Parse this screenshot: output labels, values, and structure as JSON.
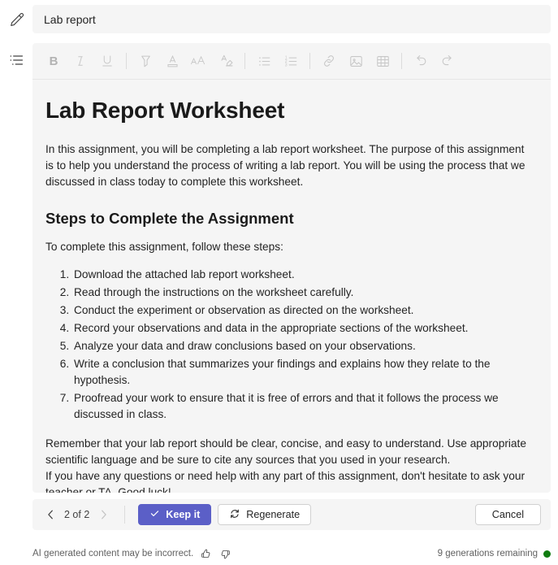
{
  "rail": {
    "items": [
      {
        "name": "edit-icon",
        "label": "Edit"
      },
      {
        "name": "format-list-icon",
        "label": "Formatting options"
      }
    ]
  },
  "title_field": {
    "value": "Lab report",
    "placeholder": "Title"
  },
  "toolbar": {
    "items": [
      {
        "name": "bold-button",
        "label": "B",
        "tooltip": "Bold"
      },
      {
        "name": "italic-button",
        "label": "I",
        "tooltip": "Italic"
      },
      {
        "name": "underline-button",
        "label": "U",
        "tooltip": "Underline"
      },
      {
        "name": "highlight-button",
        "label": "",
        "tooltip": "Highlight"
      },
      {
        "name": "font-color-button",
        "label": "",
        "tooltip": "Font color"
      },
      {
        "name": "font-size-button",
        "label": "AA",
        "tooltip": "Font size"
      },
      {
        "name": "clear-formatting-button",
        "label": "",
        "tooltip": "Clear formatting"
      },
      {
        "name": "bulleted-list-button",
        "label": "",
        "tooltip": "Bulleted list"
      },
      {
        "name": "numbered-list-button",
        "label": "",
        "tooltip": "Numbered list"
      },
      {
        "name": "insert-link-button",
        "label": "",
        "tooltip": "Insert link"
      },
      {
        "name": "insert-image-button",
        "label": "",
        "tooltip": "Insert picture"
      },
      {
        "name": "insert-table-button",
        "label": "",
        "tooltip": "Insert table"
      },
      {
        "name": "undo-button",
        "label": "",
        "tooltip": "Undo"
      },
      {
        "name": "redo-button",
        "label": "",
        "tooltip": "Redo"
      }
    ]
  },
  "document": {
    "heading": "Lab Report Worksheet",
    "intro": "In this assignment, you will be completing a lab report worksheet. The purpose of this assignment is to help you understand the process of writing a lab report. You will be using the process that we discussed in class today to complete this worksheet.",
    "section_heading": "Steps to Complete the Assignment",
    "steps_intro": "To complete this assignment, follow these steps:",
    "steps": [
      "Download the attached lab report worksheet.",
      "Read through the instructions on the worksheet carefully.",
      "Conduct the experiment or observation as directed on the worksheet.",
      "Record your observations and data in the appropriate sections of the worksheet.",
      "Analyze your data and draw conclusions based on your observations.",
      "Write a conclusion that summarizes your findings and explains how they relate to the hypothesis.",
      "Proofread your work to ensure that it is free of errors and that it follows the process we discussed in class."
    ],
    "closing_1": "Remember that your lab report should be clear, concise, and easy to understand. Use appropriate scientific language and be sure to cite any sources that you used in your research.",
    "closing_2": "If you have any questions or need help with any part of this assignment, don't hesitate to ask your teacher or TA. Good luck!"
  },
  "actions": {
    "prev_label": "‹",
    "next_label": "›",
    "pager_label": "2 of 2",
    "keep_label": "Keep it",
    "regenerate_label": "Regenerate",
    "cancel_label": "Cancel"
  },
  "footer": {
    "disclaimer": "AI generated content may be incorrect.",
    "thumbs_up": "thumb-like-icon",
    "thumbs_down": "thumb-dislike-icon",
    "generations_remaining": "9 generations remaining"
  },
  "colors": {
    "accent": "#5b5fc7",
    "panel": "#f5f5f5",
    "status_green": "#107c10",
    "text": "#242424"
  }
}
